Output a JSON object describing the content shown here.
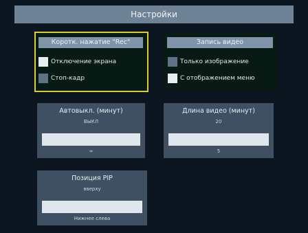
{
  "header": {
    "title": "Настройки"
  },
  "quick_press": {
    "title": "Коротк. нажатие \"Rec\"",
    "options": [
      {
        "label": "Отключение экрана",
        "checked": true
      },
      {
        "label": "Стоп-кадр",
        "checked": false
      }
    ]
  },
  "video_record": {
    "title": "Запись видео",
    "options": [
      {
        "label": "Только изображение",
        "checked": false
      },
      {
        "label": "С отображением меню",
        "checked": true
      }
    ]
  },
  "auto_shutdown": {
    "title": "Автовыкл. (минут)",
    "prev_value": "ВЫКЛ",
    "current_value": "",
    "next_value": "∞"
  },
  "video_length": {
    "title": "Длина видео (минут)",
    "prev_value": "20",
    "current_value": "",
    "next_value": "5"
  },
  "pip_position": {
    "title": "Позиция PIP",
    "prev_value": "вверху",
    "current_value": "",
    "next_value": "Нижнее слева"
  },
  "colors": {
    "selection_outline": "#e0cc2a",
    "header_bg": "#6f8396",
    "panel_bg": "#071a14",
    "checkbox_on": "#e6eef2",
    "checkbox_off": "#5e7386"
  }
}
